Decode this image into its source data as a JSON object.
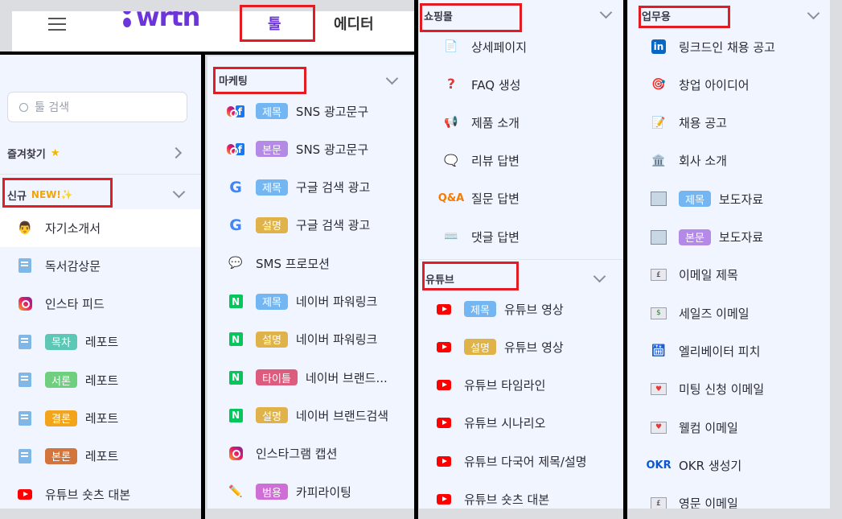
{
  "header": {
    "logo": "wrtn",
    "tab_tool": "툴",
    "tab_editor": "에디터"
  },
  "sidebar": {
    "search_placeholder": "툴 검색",
    "favorites_label": "즐겨찾기",
    "new_label": "신규",
    "new_badge": "NEW!✨",
    "items": [
      {
        "icon": "person-icon",
        "label": "자기소개서"
      },
      {
        "icon": "document-icon",
        "label": "독서감상문"
      },
      {
        "icon": "instagram-icon",
        "label": "인스타 피드"
      },
      {
        "icon": "document-icon",
        "badge": "목차",
        "badge_color": "#5cc7b4",
        "label": "레포트"
      },
      {
        "icon": "document-icon",
        "badge": "서론",
        "badge_color": "#6fcf7f",
        "label": "레포트"
      },
      {
        "icon": "document-icon",
        "badge": "결론",
        "badge_color": "#f2a51a",
        "label": "레포트"
      },
      {
        "icon": "document-icon",
        "badge": "본론",
        "badge_color": "#d2753c",
        "label": "레포트"
      },
      {
        "icon": "youtube-icon",
        "label": "유튜브 숏츠 대본"
      }
    ]
  },
  "marketing": {
    "title": "마케팅",
    "items": [
      {
        "icon": "instagram-facebook-icon",
        "badge": "제목",
        "badge_color": "#73b6f2",
        "label": "SNS 광고문구"
      },
      {
        "icon": "instagram-facebook-icon",
        "badge": "본문",
        "badge_color": "#b58ae6",
        "label": "SNS 광고문구"
      },
      {
        "icon": "google-icon",
        "badge": "제목",
        "badge_color": "#73b6f2",
        "label": "구글 검색 광고"
      },
      {
        "icon": "google-icon",
        "badge": "설명",
        "badge_color": "#dfb24a",
        "label": "구글 검색 광고"
      },
      {
        "icon": "speech-bubble-icon",
        "label": "SMS 프로모션"
      },
      {
        "icon": "naver-icon",
        "badge": "제목",
        "badge_color": "#73b6f2",
        "label": "네이버 파워링크"
      },
      {
        "icon": "naver-icon",
        "badge": "설명",
        "badge_color": "#dfb24a",
        "label": "네이버 파워링크"
      },
      {
        "icon": "naver-icon",
        "badge": "타이틀",
        "badge_color": "#dd5c7d",
        "label": "네이버 브랜드..."
      },
      {
        "icon": "naver-icon",
        "badge": "설명",
        "badge_color": "#dfb24a",
        "label": "네이버 브랜드검색"
      },
      {
        "icon": "instagram-icon",
        "label": "인스타그램 캡션"
      },
      {
        "icon": "pencil-icon",
        "badge": "범용",
        "badge_color": "#cf6fd6",
        "label": "카피라이팅"
      }
    ]
  },
  "shopping": {
    "title": "쇼핑몰",
    "items": [
      {
        "icon": "page-icon",
        "label": "상세페이지"
      },
      {
        "icon": "question-icon",
        "label": "FAQ 생성"
      },
      {
        "icon": "megaphone-icon",
        "label": "제품 소개"
      },
      {
        "icon": "bubble-icon",
        "label": "리뷰 답변"
      },
      {
        "icon": "qa-icon",
        "icon_text": "Q&A",
        "label": "질문 답변"
      },
      {
        "icon": "keyboard-icon",
        "label": "댓글 답변"
      }
    ]
  },
  "youtube": {
    "title": "유튜브",
    "items": [
      {
        "badge": "제목",
        "badge_color": "#73b6f2",
        "label": "유튜브 영상"
      },
      {
        "badge": "설명",
        "badge_color": "#dfb24a",
        "label": "유튜브 영상"
      },
      {
        "label": "유튜브 타임라인"
      },
      {
        "label": "유튜브 시나리오"
      },
      {
        "label": "유튜브 다국어 제목/설명"
      },
      {
        "label": "유튜브 숏츠 대본"
      }
    ]
  },
  "business": {
    "title": "업무용",
    "items": [
      {
        "icon": "linkedin-icon",
        "icon_text": "in",
        "label": "링크드인 채용 공고"
      },
      {
        "icon": "target-icon",
        "label": "창업 아이디어"
      },
      {
        "icon": "memo-icon",
        "label": "채용 공고"
      },
      {
        "icon": "building-icon",
        "label": "회사 소개"
      },
      {
        "icon": "newspaper-icon",
        "badge": "제목",
        "badge_color": "#73b6f2",
        "label": "보도자료"
      },
      {
        "icon": "newspaper-icon",
        "badge": "본문",
        "badge_color": "#b58ae6",
        "label": "보도자료"
      },
      {
        "icon": "envelope-icon",
        "label": "이메일 제목"
      },
      {
        "icon": "envelope-dollar-icon",
        "label": "세일즈 이메일"
      },
      {
        "icon": "elevator-icon",
        "label": "엘리베이터 피치"
      },
      {
        "icon": "envelope-heart-icon",
        "label": "미팅 신청 이메일"
      },
      {
        "icon": "envelope-heart-icon",
        "label": "웰컴 이메일"
      },
      {
        "icon": "okr-icon",
        "icon_text": "OKR",
        "label": "OKR 생성기"
      },
      {
        "icon": "envelope-icon",
        "label": "영문 이메일"
      }
    ]
  }
}
